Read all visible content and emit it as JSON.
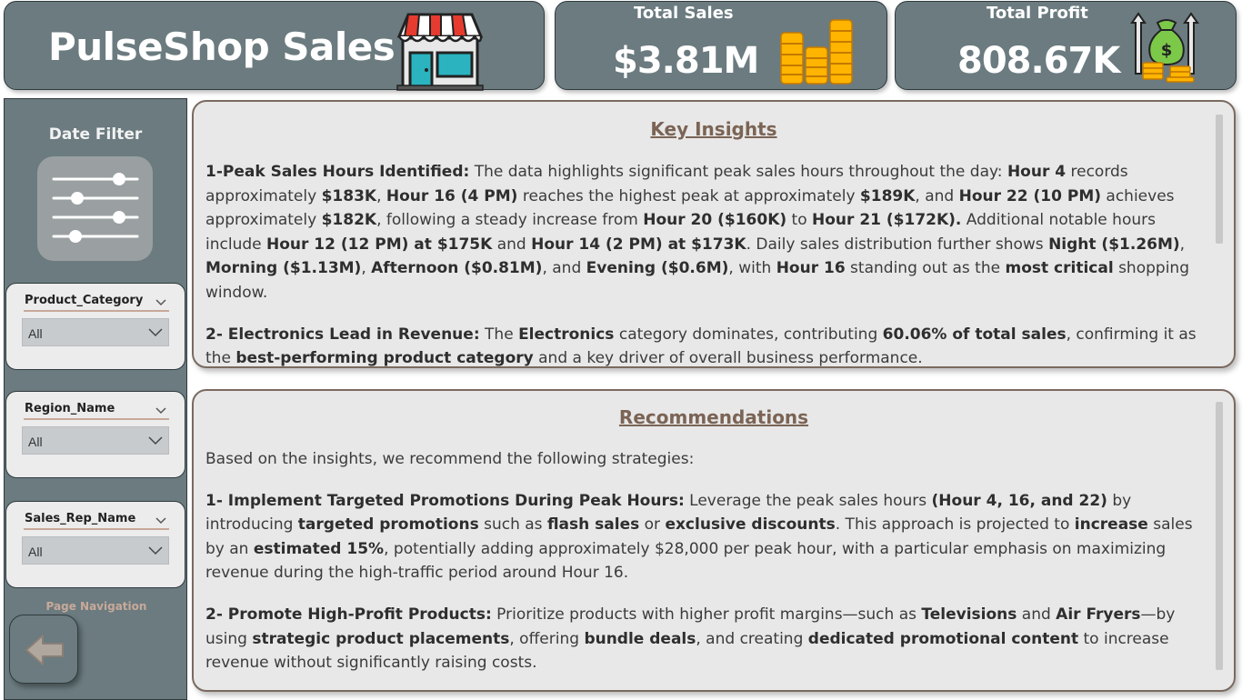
{
  "header": {
    "title": "PulseShop Sales",
    "kpis": [
      {
        "label": "Total Sales",
        "value": "$3.81M",
        "icon": "coin-stacks-icon"
      },
      {
        "label": "Total Profit",
        "value": "808.67K",
        "icon": "money-bag-growth-icon"
      }
    ],
    "store_icon": "storefront-icon"
  },
  "sidebar": {
    "date_filter_label": "Date Filter",
    "filter_icon": "sliders-icon",
    "slicers": [
      {
        "title": "Product_Category",
        "value": "All"
      },
      {
        "title": "Region_Name",
        "value": "All"
      },
      {
        "title": "Sales_Rep_Name",
        "value": "All"
      }
    ],
    "page_nav_label": "Page Navigation",
    "back_icon": "arrow-left-icon"
  },
  "insights": {
    "heading": "Key Insights",
    "p1": {
      "t0": "1-Peak Sales Hours Identified:",
      "t1": " The data highlights significant peak sales hours throughout the day: ",
      "t2": "Hour 4",
      "t3": " records approximately ",
      "t4": "$183K",
      "t5": ", ",
      "t6": "Hour 16 (4 PM)",
      "t7": " reaches the highest peak at approximately ",
      "t8": "$189K",
      "t9": ", and ",
      "t10": "Hour 22 (10 PM)",
      "t11": " achieves approximately ",
      "t12": "$182K",
      "t13": ", following a steady increase from ",
      "t14": "Hour 20 ($160K)",
      "t15": " to ",
      "t16": "Hour 21 ($172K).",
      "t17": " Additional notable hours include ",
      "t18": "Hour 12 (12 PM) at $175K",
      "t19": " and ",
      "t20": "Hour 14 (2 PM) at $173K",
      "t21": ". Daily sales distribution further shows ",
      "t22": "Night ($1.26M)",
      "t23": ", ",
      "t24": "Morning ($1.13M)",
      "t25": ", ",
      "t26": "Afternoon ($0.81M)",
      "t27": ", and ",
      "t28": "Evening ($0.6M)",
      "t29": ", with ",
      "t30": "Hour 16",
      "t31": " standing out as the ",
      "t32": "most critical",
      "t33": " shopping window."
    },
    "p2": {
      "t0": "2- Electronics Lead in Revenue:",
      "t1": " The ",
      "t2": "Electronics",
      "t3": " category dominates, contributing ",
      "t4": "60.06% of total sales",
      "t5": ", confirming it as the ",
      "t6": "best-performing product category",
      "t7": " and a key driver of overall business performance."
    }
  },
  "recommendations": {
    "heading": "Recommendations",
    "intro": "Based on the insights, we recommend the following strategies:",
    "r1": {
      "t0": "1- Implement Targeted Promotions During Peak Hours:",
      "t1": " Leverage the peak sales hours ",
      "t2": "(Hour 4, 16, and 22)",
      "t3": " by introducing ",
      "t4": "targeted promotions",
      "t5": " such as ",
      "t6": "flash sales",
      "t7": " or ",
      "t8": "exclusive discounts",
      "t9": ". This approach is projected to ",
      "t10": "increase",
      "t11": " sales by an ",
      "t12": "estimated 15%",
      "t13": ", potentially adding approximately $28,000 per peak hour, with a particular emphasis on maximizing revenue during the high-traffic period around Hour 16."
    },
    "r2": {
      "t0": "2- Promote High-Profit Products:",
      "t1": " Prioritize products with higher profit margins—such as ",
      "t2": "Televisions",
      "t3": " and ",
      "t4": "Air Fryers",
      "t5": "—by using ",
      "t6": "strategic product placements",
      "t7": ", offering ",
      "t8": "bundle deals",
      "t9": ", and creating ",
      "t10": "dedicated promotional content",
      "t11": " to increase revenue without significantly raising costs."
    }
  }
}
